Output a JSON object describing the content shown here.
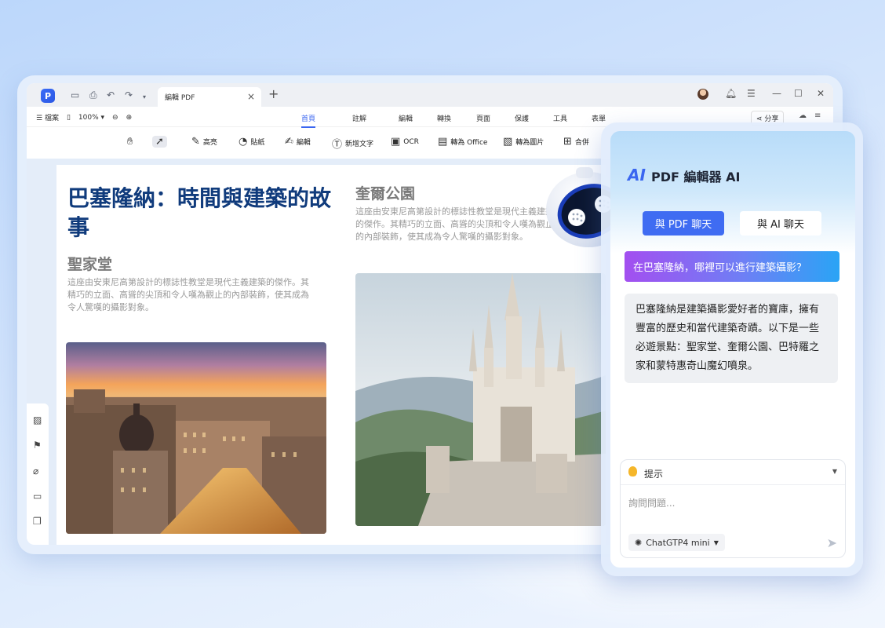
{
  "window": {
    "tab_title": "編輯 PDF",
    "tab_close": "×",
    "new_tab": "+"
  },
  "menubar": {
    "file": "檔案",
    "zoom": "100%",
    "tabs": [
      "首頁",
      "註解",
      "編輯",
      "轉換",
      "頁面",
      "保護",
      "工具",
      "表單"
    ],
    "active_tab": "首頁",
    "share": "分享"
  },
  "toolbar": {
    "tools": [
      {
        "label": "高亮",
        "icon": "highlight-icon"
      },
      {
        "label": "貼紙",
        "icon": "sticker-icon"
      },
      {
        "label": "編輯",
        "icon": "edit-icon"
      },
      {
        "label": "新增文字",
        "icon": "add-text-icon"
      },
      {
        "label": "OCR",
        "icon": "ocr-icon"
      },
      {
        "label": "轉為 Office",
        "icon": "to-office-icon"
      },
      {
        "label": "轉為圖片",
        "icon": "to-image-icon"
      },
      {
        "label": "合併",
        "icon": "merge-icon"
      }
    ]
  },
  "document": {
    "title": "巴塞隆納：時間與建築的故事",
    "section1_heading": "聖家堂",
    "section1_body": "這座由安東尼高第設計的標誌性教堂是現代主義建築的傑作。其精巧的立面、高聳的尖頂和令人嘆為觀止的內部裝飾，使其成為令人驚嘆的攝影對象。",
    "section2_heading": "奎爾公園",
    "section2_body": "這座由安東尼高第設計的標誌性教堂是現代主義建築的傑作。其精巧的立面、高聳的尖頂和令人嘆為觀止的內部裝飾，使其成為令人驚嘆的攝影對象。"
  },
  "ai_panel": {
    "logo": "AI",
    "title": "PDF 編輯器 AI",
    "chat_pdf_button": "與 PDF 聊天",
    "chat_ai_button": "與 AI 聊天",
    "user_question": "在巴塞隆納，哪裡可以進行建築攝影？",
    "ai_answer": "巴塞隆納是建築攝影愛好者的寶庫，擁有豐富的歷史和當代建築奇蹟。以下是一些必遊景點：聖家堂、奎爾公園、巴特羅之家和蒙特惠奇山魔幻噴泉。",
    "prompt_label": "提示",
    "input_placeholder": "詢問問題...",
    "model": "ChatGTP4 mini"
  }
}
